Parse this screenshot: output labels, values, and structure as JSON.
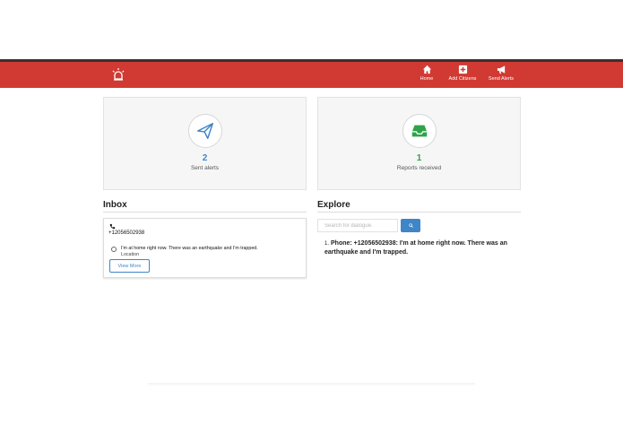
{
  "nav": {
    "logo_icon": "siren-icon",
    "items": [
      {
        "label": "Home",
        "icon": "home-icon"
      },
      {
        "label": "Add Citizens",
        "icon": "plus-square-icon"
      },
      {
        "label": "Send Alerts",
        "icon": "megaphone-icon"
      }
    ],
    "bar_color": "#d13a33"
  },
  "stats": [
    {
      "value": "2",
      "label": "Sent alerts",
      "icon": "paper-plane-icon",
      "color": "#3f86c8"
    },
    {
      "value": "1",
      "label": "Reports received",
      "icon": "inbox-tray-icon",
      "color": "#2fa34a"
    }
  ],
  "inbox": {
    "title": "Inbox",
    "phone": "+12056502938",
    "message": "I'm at home right now. There was an earthquake and I'm trapped.",
    "location_label": "Location",
    "view_more": "View More"
  },
  "explore": {
    "title": "Explore",
    "search_placeholder": "Search for dialogue.",
    "results": [
      {
        "number": "1.",
        "text": "Phone: +12056502938: I'm at home right now. There was an earthquake and I'm trapped."
      }
    ]
  }
}
